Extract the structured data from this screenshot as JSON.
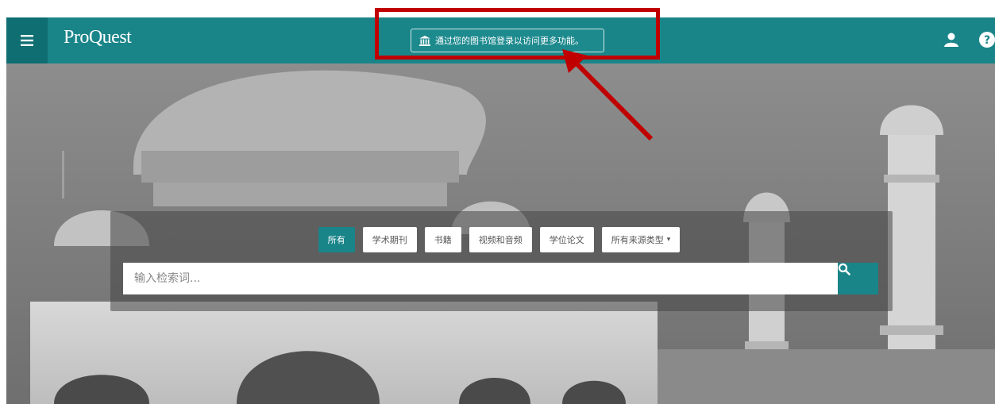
{
  "header": {
    "logo": "ProQuest",
    "login_prompt": "通过您的图书馆登录以访问更多功能。",
    "menu_icon": "hamburger-icon",
    "user_icon": "user-icon",
    "help_icon": "question-icon"
  },
  "search": {
    "tabs": [
      {
        "label": "所有",
        "active": true
      },
      {
        "label": "学术期刊",
        "active": false
      },
      {
        "label": "书籍",
        "active": false
      },
      {
        "label": "视频和音频",
        "active": false
      },
      {
        "label": "学位论文",
        "active": false
      },
      {
        "label": "所有来源类型",
        "active": false,
        "dropdown": true
      }
    ],
    "placeholder": "输入检索词...",
    "button_icon": "search-icon"
  },
  "colors": {
    "brand": "#1a8589",
    "brand_dark": "#0f6e72",
    "annotation": "#c00000"
  }
}
